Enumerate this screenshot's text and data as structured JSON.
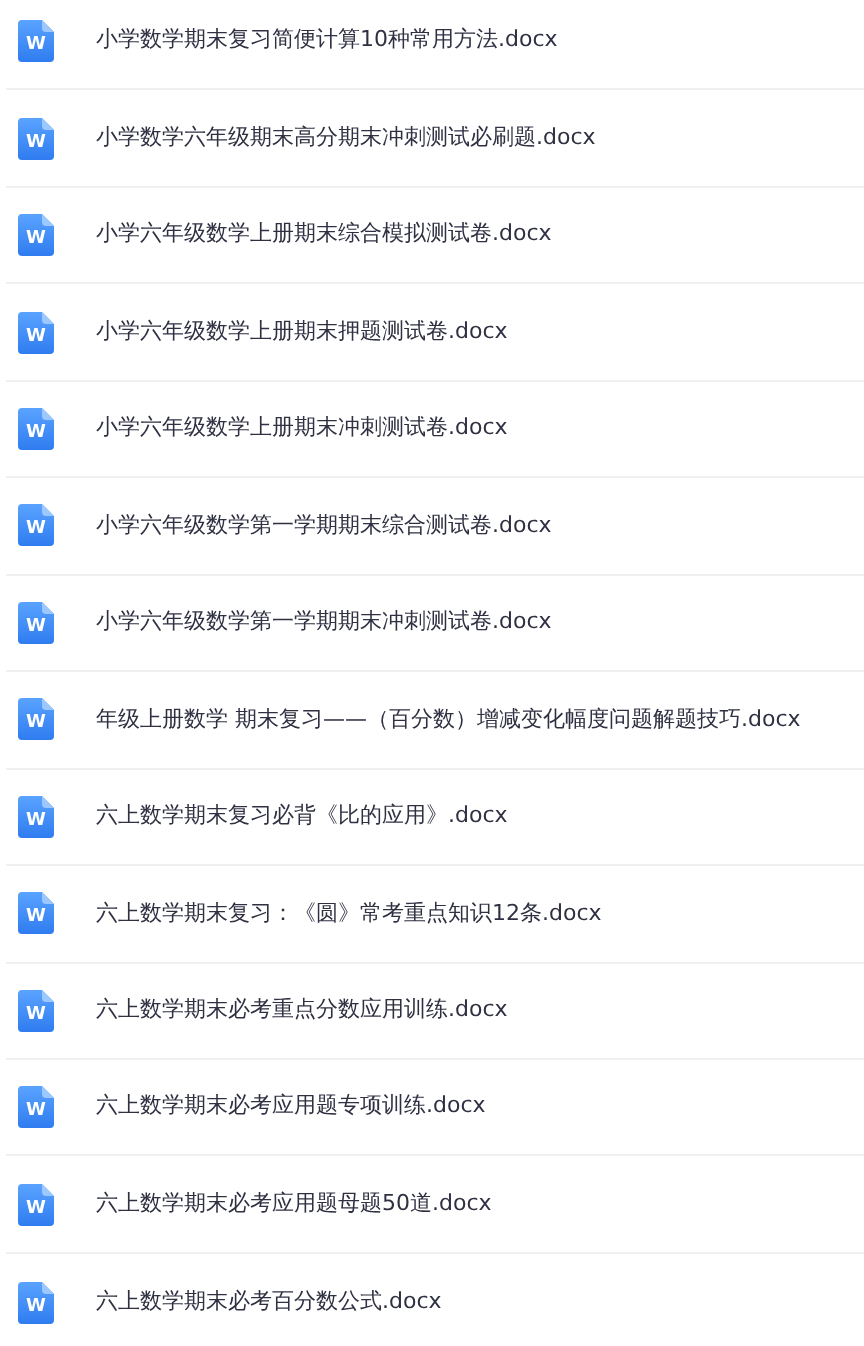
{
  "files": [
    {
      "icon_letter": "W",
      "name": "小学数学期末复习简便计算10种常用方法.docx"
    },
    {
      "icon_letter": "W",
      "name": "小学数学六年级期末高分期末冲刺测试必刷题.docx"
    },
    {
      "icon_letter": "W",
      "name": "小学六年级数学上册期末综合模拟测试卷.docx"
    },
    {
      "icon_letter": "W",
      "name": "小学六年级数学上册期末押题测试卷.docx"
    },
    {
      "icon_letter": "W",
      "name": "小学六年级数学上册期末冲刺测试卷.docx"
    },
    {
      "icon_letter": "W",
      "name": "小学六年级数学第一学期期末综合测试卷.docx"
    },
    {
      "icon_letter": "W",
      "name": "小学六年级数学第一学期期末冲刺测试卷.docx"
    },
    {
      "icon_letter": "W",
      "name": "年级上册数学 期末复习——（百分数）增减变化幅度问题解题技巧.docx"
    },
    {
      "icon_letter": "W",
      "name": "六上数学期末复习必背《比的应用》.docx"
    },
    {
      "icon_letter": "W",
      "name": "六上数学期末复习：《圆》常考重点知识12条.docx"
    },
    {
      "icon_letter": "W",
      "name": "六上数学期末必考重点分数应用训练.docx"
    },
    {
      "icon_letter": "W",
      "name": "六上数学期末必考应用题专项训练.docx"
    },
    {
      "icon_letter": "W",
      "name": "六上数学期末必考应用题母题50道.docx"
    },
    {
      "icon_letter": "W",
      "name": "六上数学期末必考百分数公式.docx"
    }
  ]
}
